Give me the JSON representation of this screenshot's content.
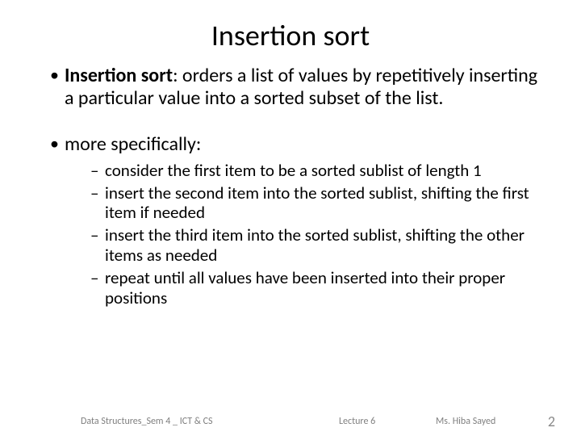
{
  "title": "Insertion sort",
  "bullets": [
    {
      "lead": "Insertion sort",
      "rest": ": orders a list of values by repetitively inserting a particular value into a sorted subset of the list."
    },
    {
      "lead": "",
      "rest": "more specifically:",
      "sub": [
        "consider the first item to be a sorted sublist of length 1",
        "insert the second item into the sorted sublist, shifting the first item if needed",
        "insert the third item into the sorted sublist, shifting the other items as needed",
        "repeat until all values have been inserted into their proper positions"
      ]
    }
  ],
  "footer": {
    "left": "Data Structures_Sem 4 _ ICT & CS",
    "mid": "Lecture 6",
    "right": "Ms. Hiba Sayed",
    "num": "2"
  }
}
